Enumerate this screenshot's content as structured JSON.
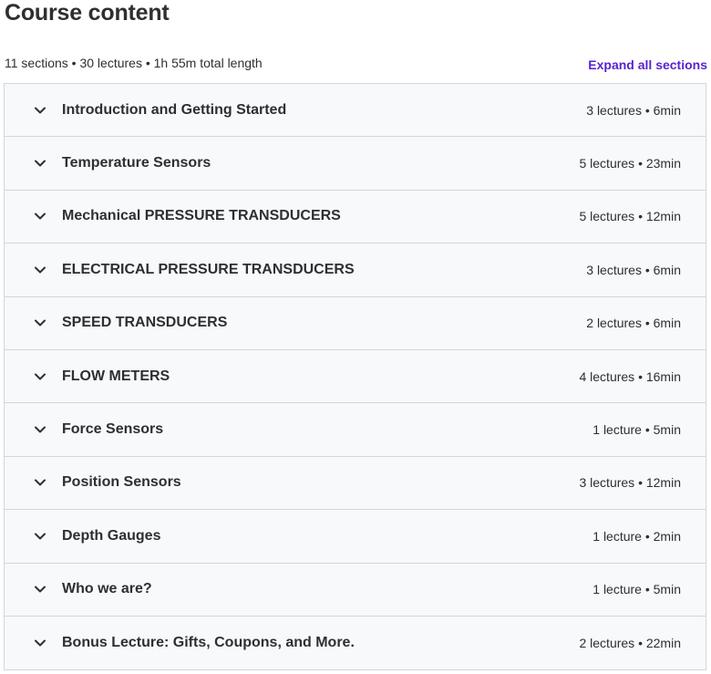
{
  "header": {
    "title": "Course content",
    "summary": "11 sections • 30 lectures • 1h 55m total length",
    "expand_all_label": "Expand all sections"
  },
  "icons": {
    "section_toggle": "chevron-down-icon"
  },
  "colors": {
    "accent": "#5624d0",
    "section_bg": "#f7f9fa",
    "border": "#d1d7dc",
    "text": "#2d2f31"
  },
  "sections": [
    {
      "title": "Introduction and Getting Started",
      "meta": "3 lectures • 6min"
    },
    {
      "title": "Temperature Sensors",
      "meta": "5 lectures • 23min"
    },
    {
      "title": "Mechanical PRESSURE TRANSDUCERS",
      "meta": "5 lectures • 12min"
    },
    {
      "title": "ELECTRICAL PRESSURE TRANSDUCERS",
      "meta": "3 lectures • 6min"
    },
    {
      "title": "SPEED TRANSDUCERS",
      "meta": "2 lectures • 6min"
    },
    {
      "title": "FLOW METERS",
      "meta": "4 lectures • 16min"
    },
    {
      "title": "Force Sensors",
      "meta": "1 lecture • 5min"
    },
    {
      "title": "Position Sensors",
      "meta": "3 lectures • 12min"
    },
    {
      "title": "Depth Gauges",
      "meta": "1 lecture • 2min"
    },
    {
      "title": "Who we are?",
      "meta": "1 lecture • 5min"
    },
    {
      "title": "Bonus Lecture: Gifts, Coupons, and More.",
      "meta": "2 lectures • 22min"
    }
  ]
}
